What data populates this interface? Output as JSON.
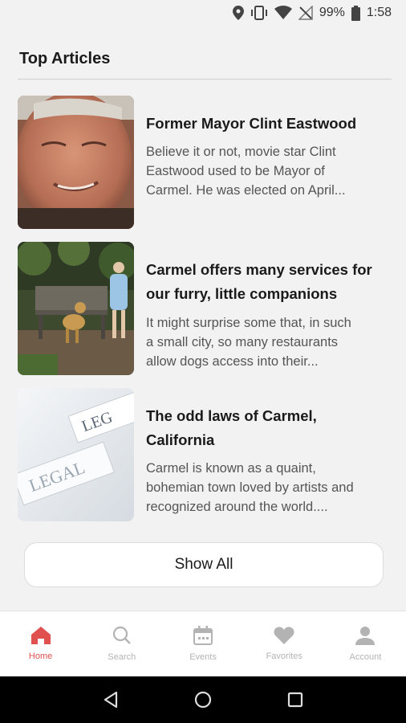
{
  "status_bar": {
    "battery": "99%",
    "time": "1:58",
    "icons": [
      "location-icon",
      "vibrate-icon",
      "wifi-icon",
      "no-signal-icon",
      "battery-icon"
    ]
  },
  "section": {
    "title": "Top Articles"
  },
  "articles": [
    {
      "title": "Former Mayor Clint Eastwood",
      "excerpt_lines": [
        "Believe it or not, movie star Clint",
        "Eastwood used to be Mayor of",
        "Carmel. He was elected on April..."
      ],
      "thumbnail": "clint-eastwood-portrait"
    },
    {
      "title_lines": [
        "Carmel offers many services for",
        "our furry, little companions"
      ],
      "excerpt_lines": [
        "It might surprise some that, in such",
        "a small city, so many restaurants",
        "allow dogs access into their..."
      ],
      "thumbnail": "dog-on-bench-photo"
    },
    {
      "title_lines": [
        "The odd laws of Carmel,",
        "California"
      ],
      "excerpt_lines": [
        "Carmel is known as a quaint,",
        "bohemian town loved by artists and",
        "recognized around the world...."
      ],
      "thumbnail": "legal-cards-photo"
    }
  ],
  "show_all_label": "Show All",
  "bottom_nav": {
    "items": [
      {
        "label": "Home",
        "icon": "home-icon",
        "active": true
      },
      {
        "label": "Search",
        "icon": "search-icon",
        "active": false
      },
      {
        "label": "Events",
        "icon": "calendar-icon",
        "active": false
      },
      {
        "label": "Favorites",
        "icon": "heart-icon",
        "active": false
      },
      {
        "label": "Account",
        "icon": "person-icon",
        "active": false
      }
    ]
  },
  "colors": {
    "accent": "#e0504f",
    "inactive": "#b3b3b3",
    "background": "#f2f2f2"
  }
}
